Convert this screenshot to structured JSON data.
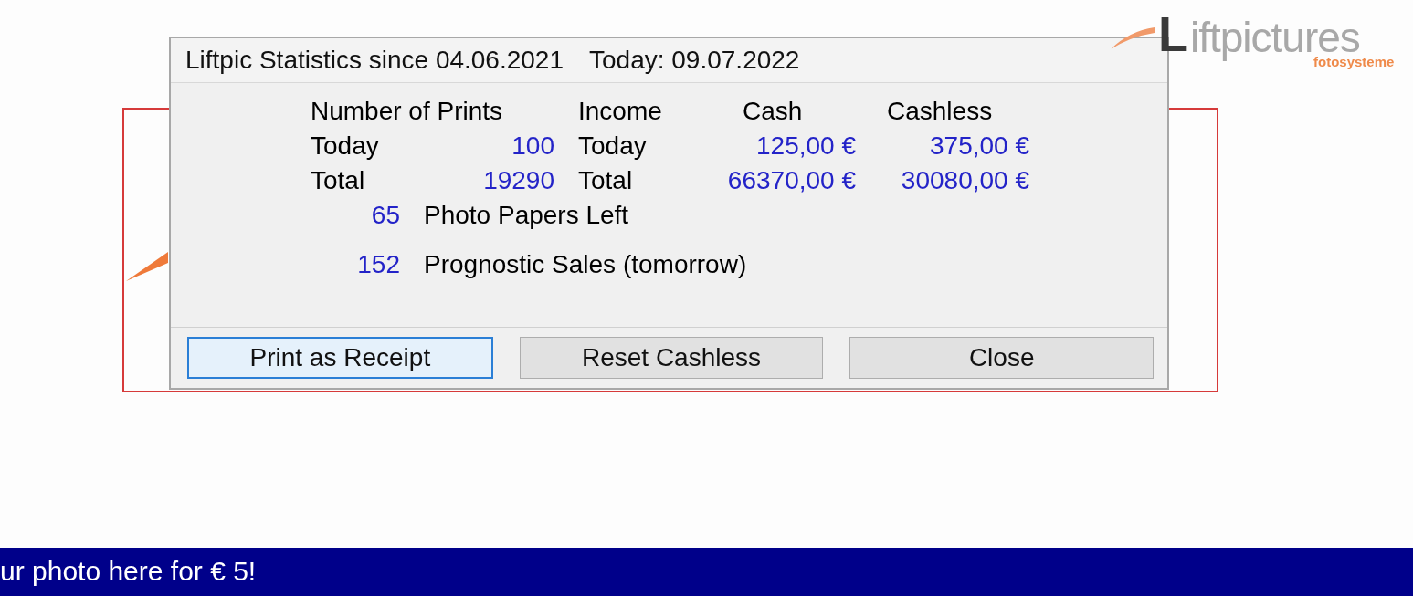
{
  "logo": {
    "initial": "L",
    "name": "iftpictures",
    "tagline": "fotosysteme"
  },
  "dialog": {
    "title": "Liftpic Statistics since 04.06.2021",
    "today": "Today: 09.07.2022",
    "headers": [
      "Number of Prints",
      "Income",
      "Cash",
      "Cashless"
    ],
    "rows": [
      {
        "prints_label": "Today",
        "prints": "100",
        "income_label": "Today",
        "cash": "125,00 €",
        "cashless": "375,00 €"
      },
      {
        "prints_label": "Total",
        "prints": "19290",
        "income_label": "Total",
        "cash": "66370,00 €",
        "cashless": "30080,00 €"
      }
    ],
    "summary": [
      {
        "value": "65",
        "label": "Photo Papers Left"
      },
      {
        "value": "152",
        "label": "Prognostic Sales (tomorrow)"
      }
    ],
    "buttons": [
      {
        "label": "Print as Receipt",
        "focused": true
      },
      {
        "label": "Reset Cashless",
        "focused": false
      },
      {
        "label": "Close",
        "focused": false
      }
    ]
  },
  "banner": {
    "text": "ur photo here for € 5!"
  }
}
